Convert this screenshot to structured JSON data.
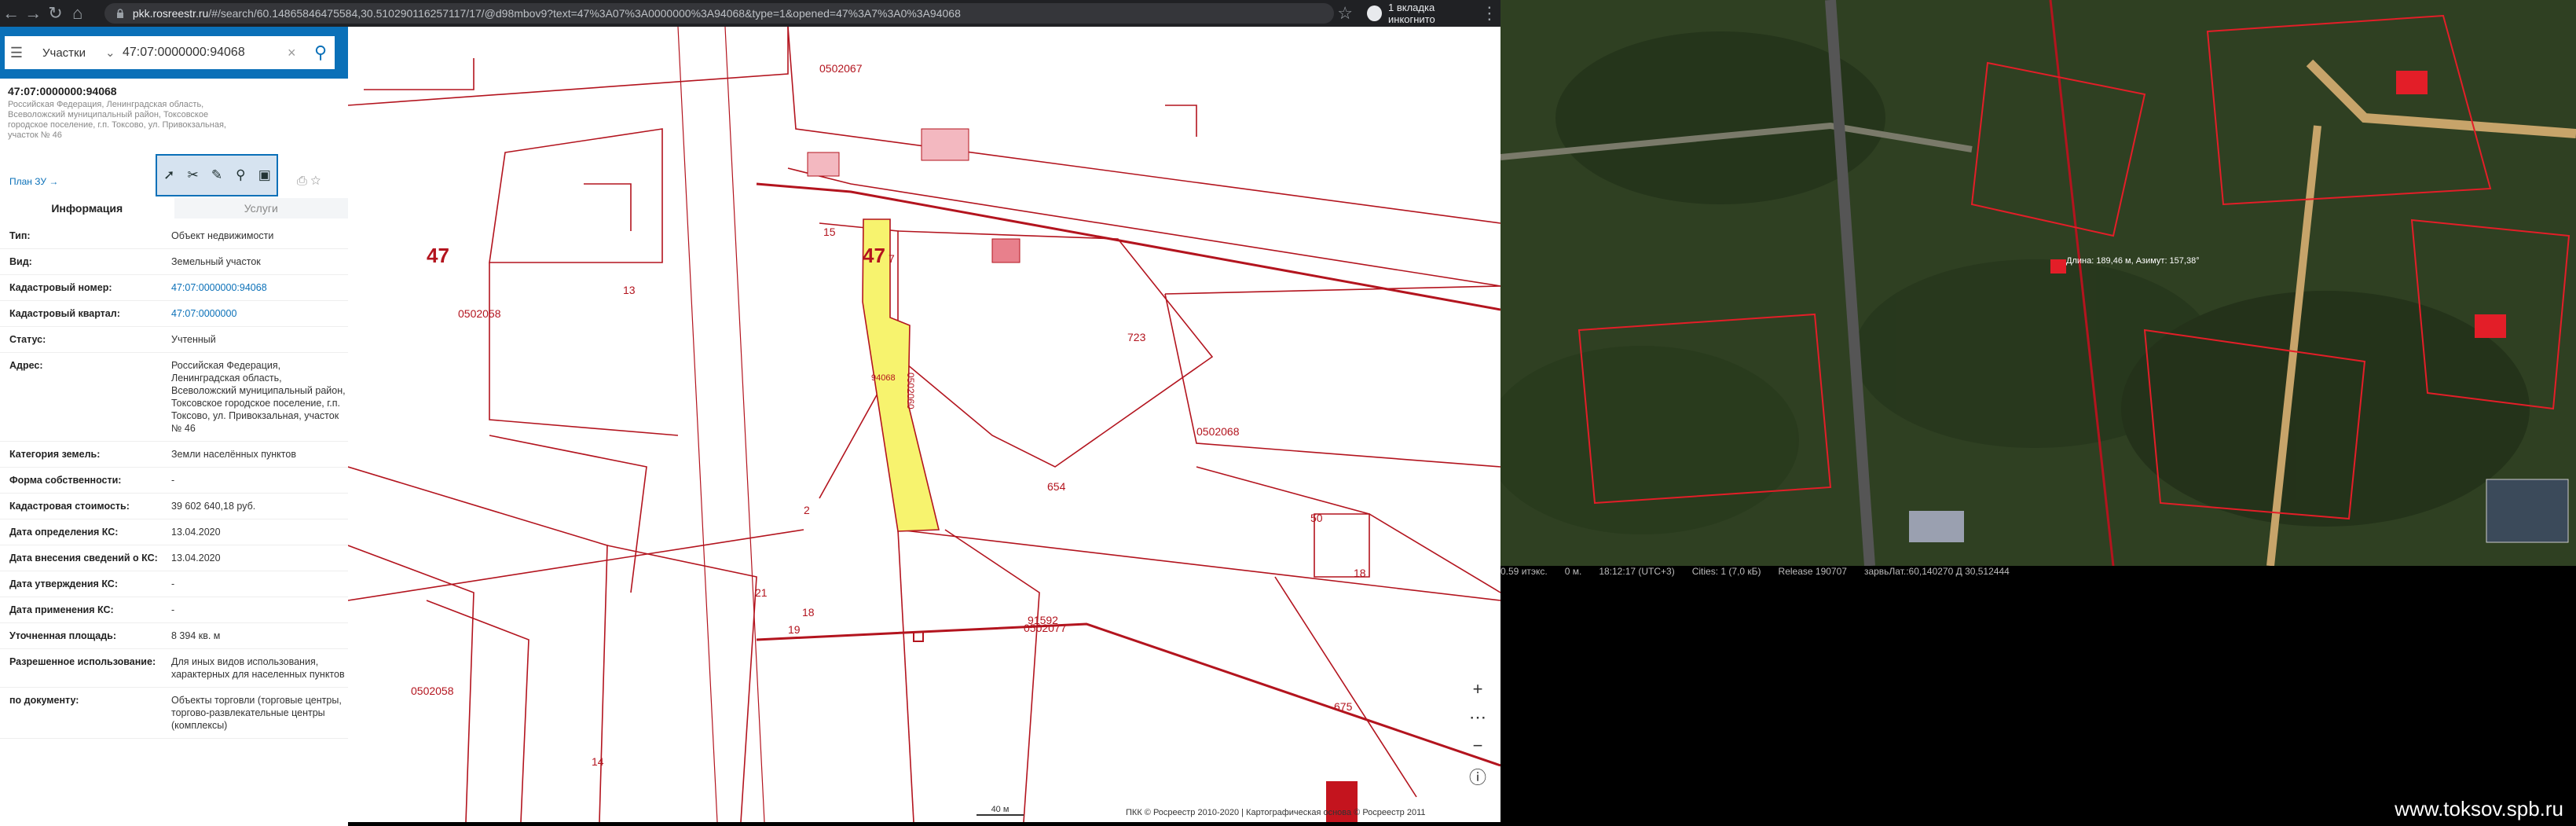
{
  "browser": {
    "url_host": "pkk.rosreestr.ru",
    "url_rest": "/#/search/60.14865846475584,30.510290116257117/17/@d98mbov9?text=47%3A07%3A0000000%3A94068&type=1&opened=47%3A7%3A0%3A94068",
    "incognito": "1 вкладка инкогнито"
  },
  "search": {
    "type": "Участки",
    "value": "47:07:0000000:94068"
  },
  "object": {
    "title": "47:07:0000000:94068",
    "subtitle": "Российская Федерация, Ленинградская область, Всеволожский муниципальный район, Токсовское городское поселение, г.п. Токсово, ул. Привокзальная, участок № 46",
    "plan_link": "План ЗУ →"
  },
  "tabs": [
    "Информация",
    "Услуги"
  ],
  "info_rows": [
    {
      "k": "Тип:",
      "v": "Объект недвижимости"
    },
    {
      "k": "Вид:",
      "v": "Земельный участок"
    },
    {
      "k": "Кадастровый номер:",
      "v": "47:07:0000000:94068"
    },
    {
      "k": "Кадастровый квартал:",
      "v": "47:07:0000000"
    },
    {
      "k": "Статус:",
      "v": "Учтенный"
    },
    {
      "k": "Адрес:",
      "v": "Российская Федерация, Ленинградская область, Всеволожский муниципальный район, Токсовское городское поселение, г.п. Токсово, ул. Привокзальная, участок № 46"
    },
    {
      "k": "Категория земель:",
      "v": "Земли населённых пунктов"
    },
    {
      "k": "Форма собственности:",
      "v": "-"
    },
    {
      "k": "Кадастровая стоимость:",
      "v": "39 602 640,18 руб."
    },
    {
      "k": "Дата определения КС:",
      "v": "13.04.2020"
    },
    {
      "k": "Дата внесения сведений о КС:",
      "v": "13.04.2020"
    },
    {
      "k": "Дата утверждения КС:",
      "v": "-"
    },
    {
      "k": "Дата применения КС:",
      "v": "-"
    },
    {
      "k": "Уточненная площадь:",
      "v": "8 394 кв. м"
    },
    {
      "k": "Разрешенное использование:",
      "v": "Для иных видов использования, характерных для населенных пунктов"
    },
    {
      "k": "по документу:",
      "v": "Объекты торговли (торговые центры, торгово-развлекательные центры (комплексы)"
    }
  ],
  "map": {
    "labels": [
      "47",
      "47",
      "0502058",
      "0502068",
      "0502077",
      "0502067",
      "13",
      "723",
      "654",
      "91592",
      "0502058",
      "2",
      "7",
      "15",
      "21",
      "18",
      "19",
      "14",
      "18",
      "675",
      "50"
    ],
    "parcel_label": "0502060",
    "parcel_num": "94068",
    "scale": "40 м",
    "copyright": "ПКК © Росреестр 2010-2020 | Картографическая основа © Росреестр 2011"
  },
  "satellite": {
    "status": [
      "0.59 итэкс.",
      "0 м.",
      "18:12:17 (UTC+3)",
      "Cities: 1 (7,0 кБ)",
      "Release 190707",
      "зарвьЛат.:60,140270 Д 30,512444"
    ],
    "tooltip": "Длина: 189,46 м, Азимут: 157,38°",
    "watermark": "www.toksov.spb.ru"
  },
  "colors": {
    "accent": "#0a70b8",
    "parcel_fill": "#f7f36e",
    "cadastre_line": "#b3141e"
  }
}
